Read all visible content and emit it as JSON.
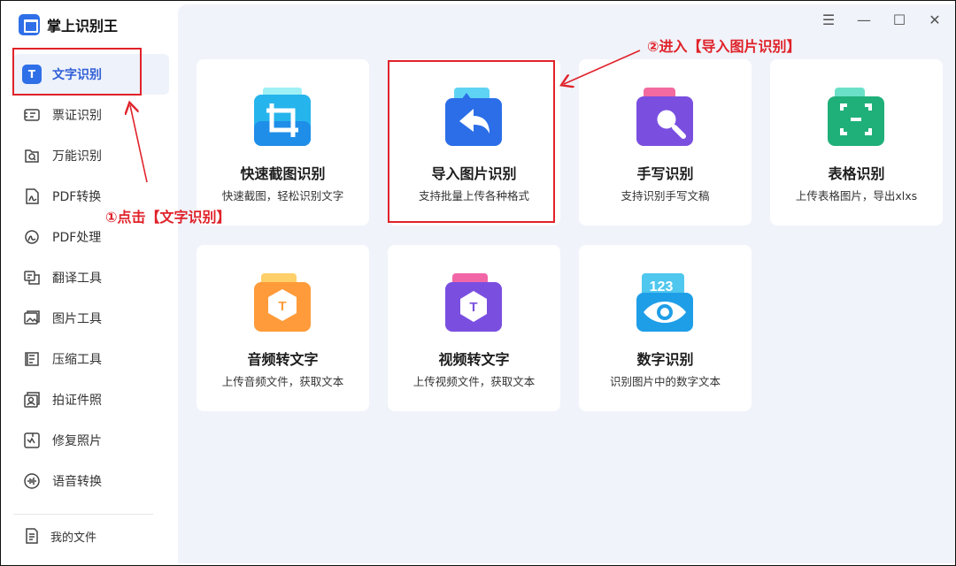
{
  "app": {
    "title": "掌上识别王"
  },
  "sidebar": {
    "items": [
      {
        "label": "文字识别",
        "icon": "text-recognition-icon",
        "active": true
      },
      {
        "label": "票证识别",
        "icon": "ticket-icon"
      },
      {
        "label": "万能识别",
        "icon": "universal-scan-icon"
      },
      {
        "label": "PDF转换",
        "icon": "pdf-convert-icon"
      },
      {
        "label": "PDF处理",
        "icon": "pdf-process-icon"
      },
      {
        "label": "翻译工具",
        "icon": "translate-icon"
      },
      {
        "label": "图片工具",
        "icon": "image-tool-icon"
      },
      {
        "label": "压缩工具",
        "icon": "compress-icon"
      },
      {
        "label": "拍证件照",
        "icon": "id-photo-icon"
      },
      {
        "label": "修复照片",
        "icon": "photo-repair-icon"
      },
      {
        "label": "语音转换",
        "icon": "voice-convert-icon"
      }
    ],
    "my_files": "我的文件"
  },
  "window_controls": {
    "menu": "☰",
    "minimize": "—",
    "maximize": "☐",
    "close": "✕"
  },
  "cards": [
    {
      "title": "快速截图识别",
      "subtitle": "快速截图，轻松识别文字",
      "icon": "screenshot-crop-icon"
    },
    {
      "title": "导入图片识别",
      "subtitle": "支持批量上传各种格式",
      "icon": "import-image-icon"
    },
    {
      "title": "手写识别",
      "subtitle": "支持识别手写文稿",
      "icon": "handwriting-search-icon"
    },
    {
      "title": "表格识别",
      "subtitle": "上传表格图片，导出xlxs",
      "icon": "table-scan-icon"
    },
    {
      "title": "音频转文字",
      "subtitle": "上传音频文件，获取文本",
      "icon": "audio-to-text-icon"
    },
    {
      "title": "视频转文字",
      "subtitle": "上传视频文件，获取文本",
      "icon": "video-to-text-icon"
    },
    {
      "title": "数字识别",
      "subtitle": "识别图片中的数字文本",
      "icon": "number-eye-icon"
    }
  ],
  "annotations": {
    "step1": "①点击【文字识别】",
    "step2": "②进入【导入图片识别】"
  },
  "colors": {
    "accent": "#2f6fe8",
    "annotation": "#e0222a",
    "main_bg": "#f0f3fa"
  }
}
